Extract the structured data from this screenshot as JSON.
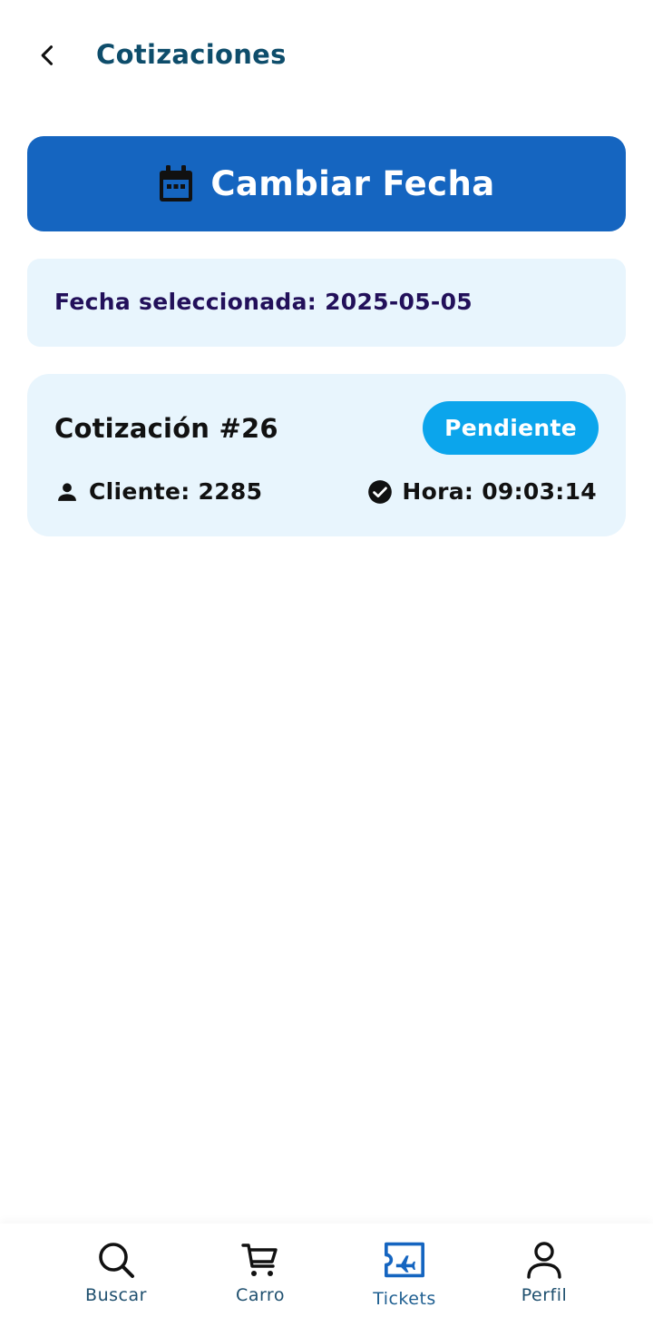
{
  "header": {
    "title": "Cotizaciones",
    "back_icon": "chevron-left-icon"
  },
  "change_date_button": {
    "label": "Cambiar Fecha",
    "icon": "calendar-icon",
    "color": "#1565c0"
  },
  "selected_date": {
    "text": "Fecha seleccionada: 2025-05-05"
  },
  "quotes": [
    {
      "title": "Cotización #26",
      "status": "Pendiente",
      "status_color": "#0ba5ec",
      "client_text": "Cliente: 2285",
      "client_icon": "person-icon",
      "time_text": "Hora: 09:03:14",
      "time_icon": "check-circle-icon"
    }
  ],
  "bottom_nav": {
    "items": [
      {
        "label": "Buscar",
        "icon": "search-icon",
        "active": false
      },
      {
        "label": "Carro",
        "icon": "cart-icon",
        "active": false
      },
      {
        "label": "Tickets",
        "icon": "ticket-icon",
        "active": true
      },
      {
        "label": "Perfil",
        "icon": "profile-icon",
        "active": false
      }
    ],
    "active_color": "#1f5f91"
  }
}
